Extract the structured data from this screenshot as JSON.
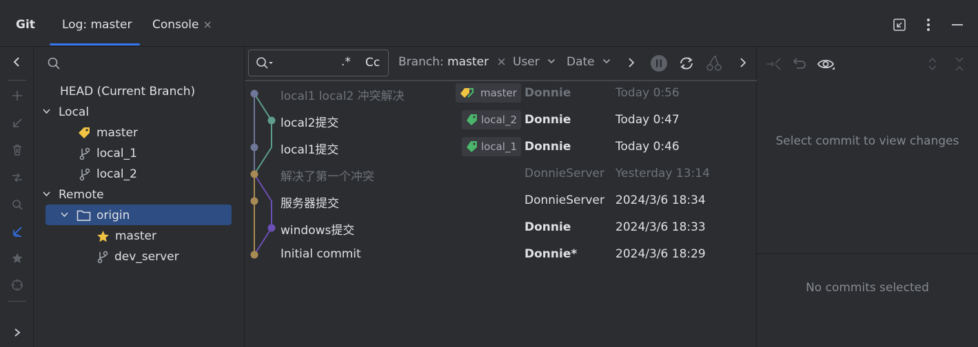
{
  "window": {
    "tool_name": "Git",
    "tabs": [
      {
        "label": "Log: master"
      },
      {
        "label": "Console",
        "close": "×"
      }
    ]
  },
  "branches": {
    "head": "HEAD (Current Branch)",
    "local_label": "Local",
    "local": [
      "master",
      "local_1",
      "local_2"
    ],
    "remote_label": "Remote",
    "origin": "origin",
    "remote_branches": [
      "master",
      "dev_server"
    ]
  },
  "log_toolbar": {
    "regex": ".*",
    "case": "Cc",
    "branch_label": "Branch:",
    "branch_value": "master",
    "branch_clear": "×",
    "user_label": "User",
    "date_label": "Date"
  },
  "commits": [
    {
      "message": "local1 local2 冲突解决",
      "ref": "master",
      "author": "Donnie",
      "date": "Today 0:56",
      "dim": true
    },
    {
      "message": "local2提交",
      "ref": "local_2",
      "author": "Donnie",
      "date": "Today 0:47",
      "dim": false
    },
    {
      "message": "local1提交",
      "ref": "local_1",
      "author": "Donnie",
      "date": "Today 0:46",
      "dim": false
    },
    {
      "message": "解决了第一个冲突",
      "ref": "",
      "author": "DonnieServer",
      "date": "Yesterday 13:14",
      "dim": true
    },
    {
      "message": "服务器提交",
      "ref": "",
      "author": "DonnieServer",
      "date": "2024/3/6 18:34",
      "dim": false
    },
    {
      "message": "windows提交",
      "ref": "",
      "author": "Donnie",
      "date": "2024/3/6 18:33",
      "dim": false
    },
    {
      "message": "Initial commit",
      "ref": "",
      "author": "Donnie*",
      "date": "2024/3/6 18:29",
      "dim": false
    }
  ],
  "details": {
    "top_message": "Select commit to view changes",
    "bottom_message": "No commits selected"
  },
  "colors": {
    "accent": "#3574f0",
    "graph_gray": "#6f7799",
    "graph_teal": "#5e9e8a",
    "graph_gold": "#a88a55",
    "graph_purple": "#6c4fb5",
    "tag_green": "#4bb56b",
    "tag_yellow": "#f0c343"
  }
}
